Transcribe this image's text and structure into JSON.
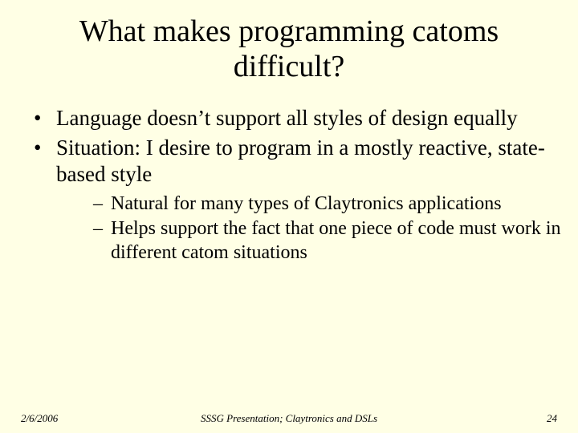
{
  "title": "What makes programming catoms difficult?",
  "bullets": {
    "b1": "Language doesn’t support all styles of design equally",
    "b2": "Situation: I desire to program in a mostly reactive, state-based style",
    "sub1": "Natural for many types of Claytronics applications",
    "sub2": "Helps support the fact that one piece of code must work in different catom situations"
  },
  "footer": {
    "date": "2/6/2006",
    "center": "SSSG Presentation; Claytronics and DSLs",
    "page": "24"
  }
}
